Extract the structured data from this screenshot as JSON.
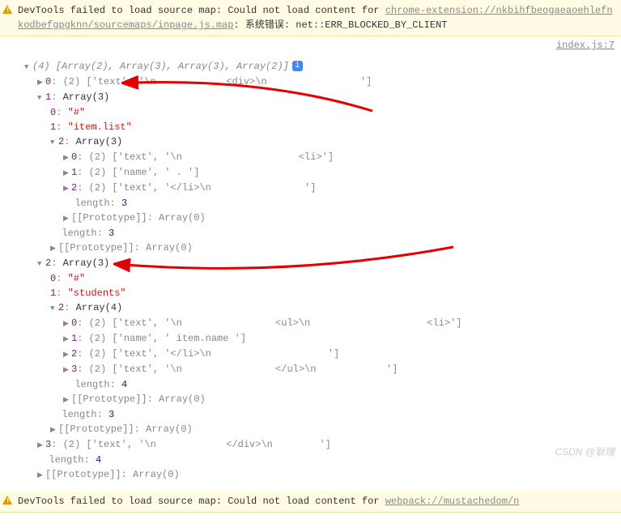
{
  "warnings": {
    "top_prefix": "DevTools failed to load source map: Could not load content for ",
    "top_url": "chrome-extension://nkbihfbeogaeaoehlefnkodbefgpgknn/sourcemaps/inpage.js.map",
    "top_suffix": ": 系统错误: net::ERR_BLOCKED_BY_CLIENT",
    "bottom_prefix": "DevTools failed to load source map: Could not load content for ",
    "bottom_url": "webpack://mustachedom/n"
  },
  "source": "index.js:7",
  "tree": {
    "root_summary": "(4) [Array(2), Array(3), Array(3), Array(2)]",
    "node0_label": "0",
    "node0_summary": "(2) ['text', '\\n            <div>\\n                ']",
    "node1_label": "1",
    "node1_summary": "Array(3)",
    "node1_k0": "0",
    "node1_v0": "\"#\"",
    "node1_k1": "1",
    "node1_v1": "\"item.list\"",
    "node1_k2": "2",
    "node1_v2": "Array(3)",
    "n1a_0": "(2) ['text', '\\n                    <li>']",
    "n1a_1": "(2) ['name', ' . ']",
    "n1a_2": "(2) ['text', '</li>\\n                ']",
    "len3": "3",
    "proto": "[[Prototype]]",
    "arr0": "Array(0)",
    "node2_label": "2",
    "node2_summary": "Array(3)",
    "node2_v0": "\"#\"",
    "node2_v1": "\"students\"",
    "node2_v2": "Array(4)",
    "n2a_0": "(2) ['text', '\\n                <ul>\\n                    <li>']",
    "n2a_1": "(2) ['name', ' item.name ']",
    "n2a_2": "(2) ['text', '</li>\\n                    ']",
    "n2a_3": "(2) ['text', '\\n                </ul>\\n            ']",
    "len4": "4",
    "node3_label": "3",
    "node3_summary": "(2) ['text', '\\n            </div>\\n        ']",
    "length_label": "length"
  },
  "watermark": "CSDN @耿瑞"
}
